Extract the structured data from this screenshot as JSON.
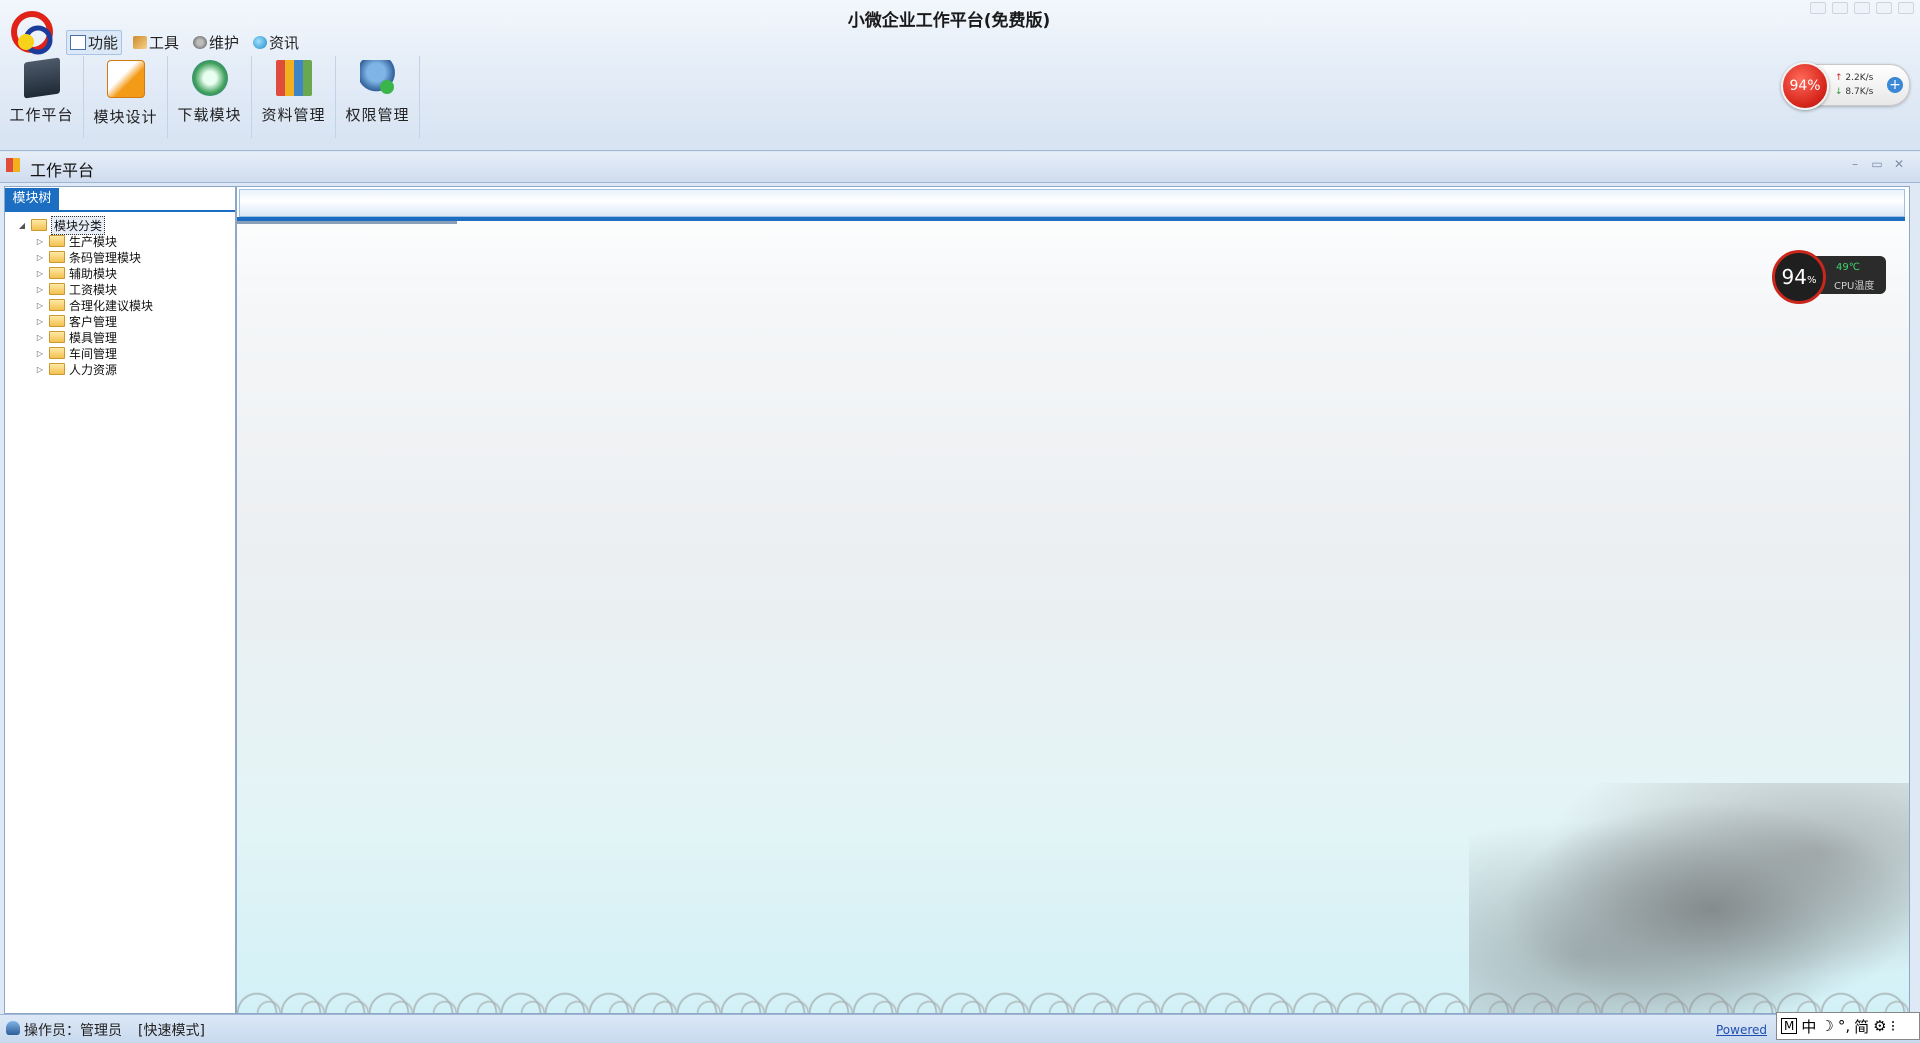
{
  "app": {
    "title": "小微企业工作平台(免费版)"
  },
  "menu": {
    "items": [
      {
        "label": "功能",
        "icon": "function-icon"
      },
      {
        "label": "工具",
        "icon": "tools-icon"
      },
      {
        "label": "维护",
        "icon": "maintenance-icon"
      },
      {
        "label": "资讯",
        "icon": "news-globe-icon"
      }
    ]
  },
  "toolbar": {
    "buttons": [
      {
        "label": "工作平台",
        "icon": "workbench-icon"
      },
      {
        "label": "模块设计",
        "icon": "module-design-icon"
      },
      {
        "label": "下载模块",
        "icon": "download-icon"
      },
      {
        "label": "资料管理",
        "icon": "documents-icon"
      },
      {
        "label": "权限管理",
        "icon": "user-permission-icon"
      }
    ]
  },
  "net_widget": {
    "percent": "94%",
    "upload": "2.2K/s",
    "download": "8.7K/s"
  },
  "child_window": {
    "title": "工作平台"
  },
  "tree_panel": {
    "tab_label": "模块树",
    "root": "模块分类",
    "children": [
      "生产模块",
      "条码管理模块",
      "辅助模块",
      "工资模块",
      "合理化建议模块",
      "客户管理",
      "模具管理",
      "车间管理",
      "人力资源"
    ]
  },
  "cpu_widget": {
    "value": "94",
    "unit": "%",
    "temperature": "49℃",
    "label": "CPU温度"
  },
  "status_bar": {
    "operator": "操作员：管理员",
    "mode": "[快速模式]",
    "powered": "Powered"
  },
  "ime": {
    "items": [
      "M",
      "中",
      "☽",
      "°,",
      "简",
      "⚙",
      "⁝"
    ]
  },
  "colors": {
    "accent": "#1b6ec2",
    "alert_red": "#d7261c"
  }
}
